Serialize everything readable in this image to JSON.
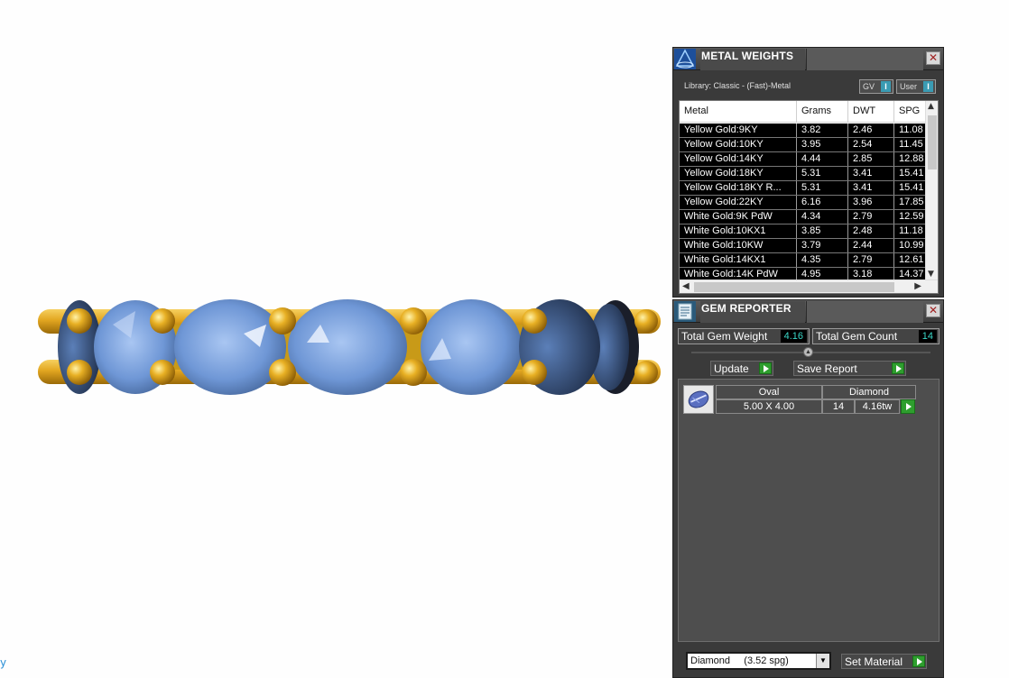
{
  "viewport": {
    "axis_glyph": "y"
  },
  "metal_weights": {
    "title": "METAL WEIGHTS",
    "close": "✕",
    "library": "Library: Classic - (Fast)-Metal",
    "gv_label": "GV",
    "user_label": "User",
    "toggle_glyph": "I",
    "columns": [
      "Metal",
      "Grams",
      "DWT",
      "SPG"
    ],
    "rows": [
      [
        "Yellow Gold:9KY",
        "3.82",
        "2.46",
        "11.08"
      ],
      [
        "Yellow Gold:10KY",
        "3.95",
        "2.54",
        "11.45"
      ],
      [
        "Yellow Gold:14KY",
        "4.44",
        "2.85",
        "12.88"
      ],
      [
        "Yellow Gold:18KY",
        "5.31",
        "3.41",
        "15.41"
      ],
      [
        "Yellow Gold:18KY R...",
        "5.31",
        "3.41",
        "15.41"
      ],
      [
        "Yellow Gold:22KY",
        "6.16",
        "3.96",
        "17.85"
      ],
      [
        "White Gold:9K PdW",
        "4.34",
        "2.79",
        "12.59"
      ],
      [
        "White Gold:10KX1",
        "3.85",
        "2.48",
        "11.18"
      ],
      [
        "White Gold:10KW",
        "3.79",
        "2.44",
        "10.99"
      ],
      [
        "White Gold:14KX1",
        "4.35",
        "2.79",
        "12.61"
      ],
      [
        "White Gold:14K PdW",
        "4.95",
        "3.18",
        "14.37"
      ]
    ]
  },
  "gem_reporter": {
    "title": "GEM REPORTER",
    "close": "✕",
    "total_weight_label": "Total Gem Weight",
    "total_weight_value": "4.16",
    "total_count_label": "Total Gem Count",
    "total_count_value": "14",
    "update_label": "Update",
    "save_label": "Save Report",
    "gem": {
      "shape": "Oval",
      "type": "Diamond",
      "size": "5.00 X 4.00",
      "count": "14",
      "weight": "4.16tw"
    },
    "material_select": "Diamond     (3.52 spg)",
    "set_material_label": "Set Material"
  },
  "colors": {
    "gem_blue": "#7aa6e0",
    "gold": "#e0a820",
    "panel_bg": "#3a3a3a",
    "go_green": "#2e9e2e",
    "value_cyan": "#3ad8c8"
  }
}
